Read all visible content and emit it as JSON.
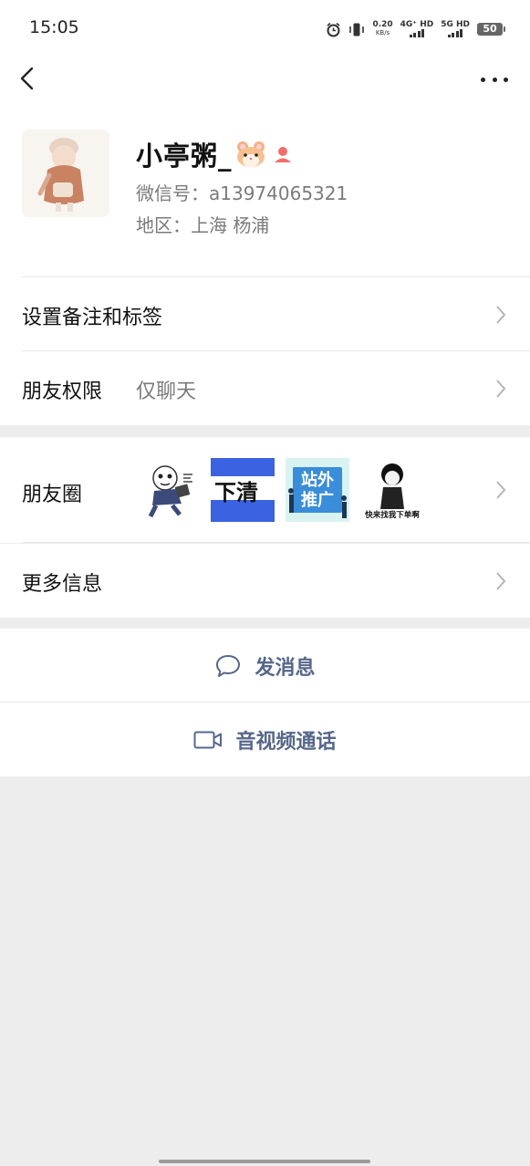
{
  "status_bar": {
    "time": "15:05",
    "net_speed_value": "0.20",
    "net_speed_unit": "KB/s",
    "signal1_label": "4G⁺ HD",
    "signal2_label": "5G HD",
    "battery": "50",
    "icons": [
      "alarm-icon",
      "vibrate-icon",
      "signal-icon",
      "battery-icon"
    ]
  },
  "top_bar": {
    "icons": [
      "back-arrow-icon",
      "more-icon"
    ]
  },
  "profile": {
    "name": "小亭粥_",
    "wechat_id": "微信号：a13974065321",
    "region": "地区：上海  杨浦",
    "icons": [
      "hamster-emoji-icon",
      "female-gender-icon"
    ]
  },
  "rows": {
    "remark": {
      "label": "设置备注和标签"
    },
    "permission": {
      "label": "朋友权限",
      "value": "仅聊天"
    },
    "moments": {
      "label": "朋友圈",
      "thumbnails": [
        {
          "name": "moment-thumb-1",
          "caption": "",
          "bg": "#ffffff"
        },
        {
          "name": "moment-thumb-2",
          "caption": "下清",
          "bg": "#3b62e0"
        },
        {
          "name": "moment-thumb-3",
          "caption": "站外推广",
          "bg": "#d9f3f0"
        },
        {
          "name": "moment-thumb-4",
          "caption": "快来找我下单啊",
          "bg": "#ffffff"
        }
      ]
    },
    "more_info": {
      "label": "更多信息"
    }
  },
  "actions": {
    "message": {
      "label": "发消息",
      "icon": "chat-bubble-icon"
    },
    "call": {
      "label": "音视频通话",
      "icon": "video-camera-icon"
    }
  },
  "colors": {
    "action_text": "#55678a",
    "background": "#ededed",
    "card": "#ffffff",
    "secondary_text": "#7a7a7a",
    "gender_female": "#f26d6d"
  }
}
